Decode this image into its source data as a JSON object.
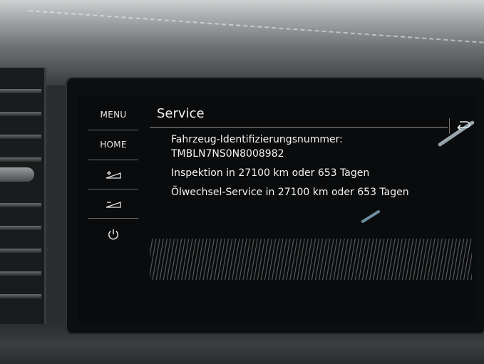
{
  "sidebar": {
    "menu_label": "MENU",
    "home_label": "HOME",
    "brightness_up_icon": "brightness-up-icon",
    "brightness_down_icon": "brightness-down-icon",
    "power_icon": "power-icon"
  },
  "header": {
    "title": "Service",
    "back_icon": "back-arrow-icon"
  },
  "service_info": {
    "vin_label": "Fahrzeug-Identifizierungsnummer:",
    "vin_value": "TMBLN7NS0N8008982",
    "inspection": "Inspektion in 27100 km oder 653 Tagen",
    "oil_service": "Ölwechsel-Service in 27100 km oder 653 Tagen"
  },
  "colors": {
    "screen_bg": "#0a0b0c",
    "text": "#f2f2f2",
    "divider": "#6a6c6e"
  }
}
